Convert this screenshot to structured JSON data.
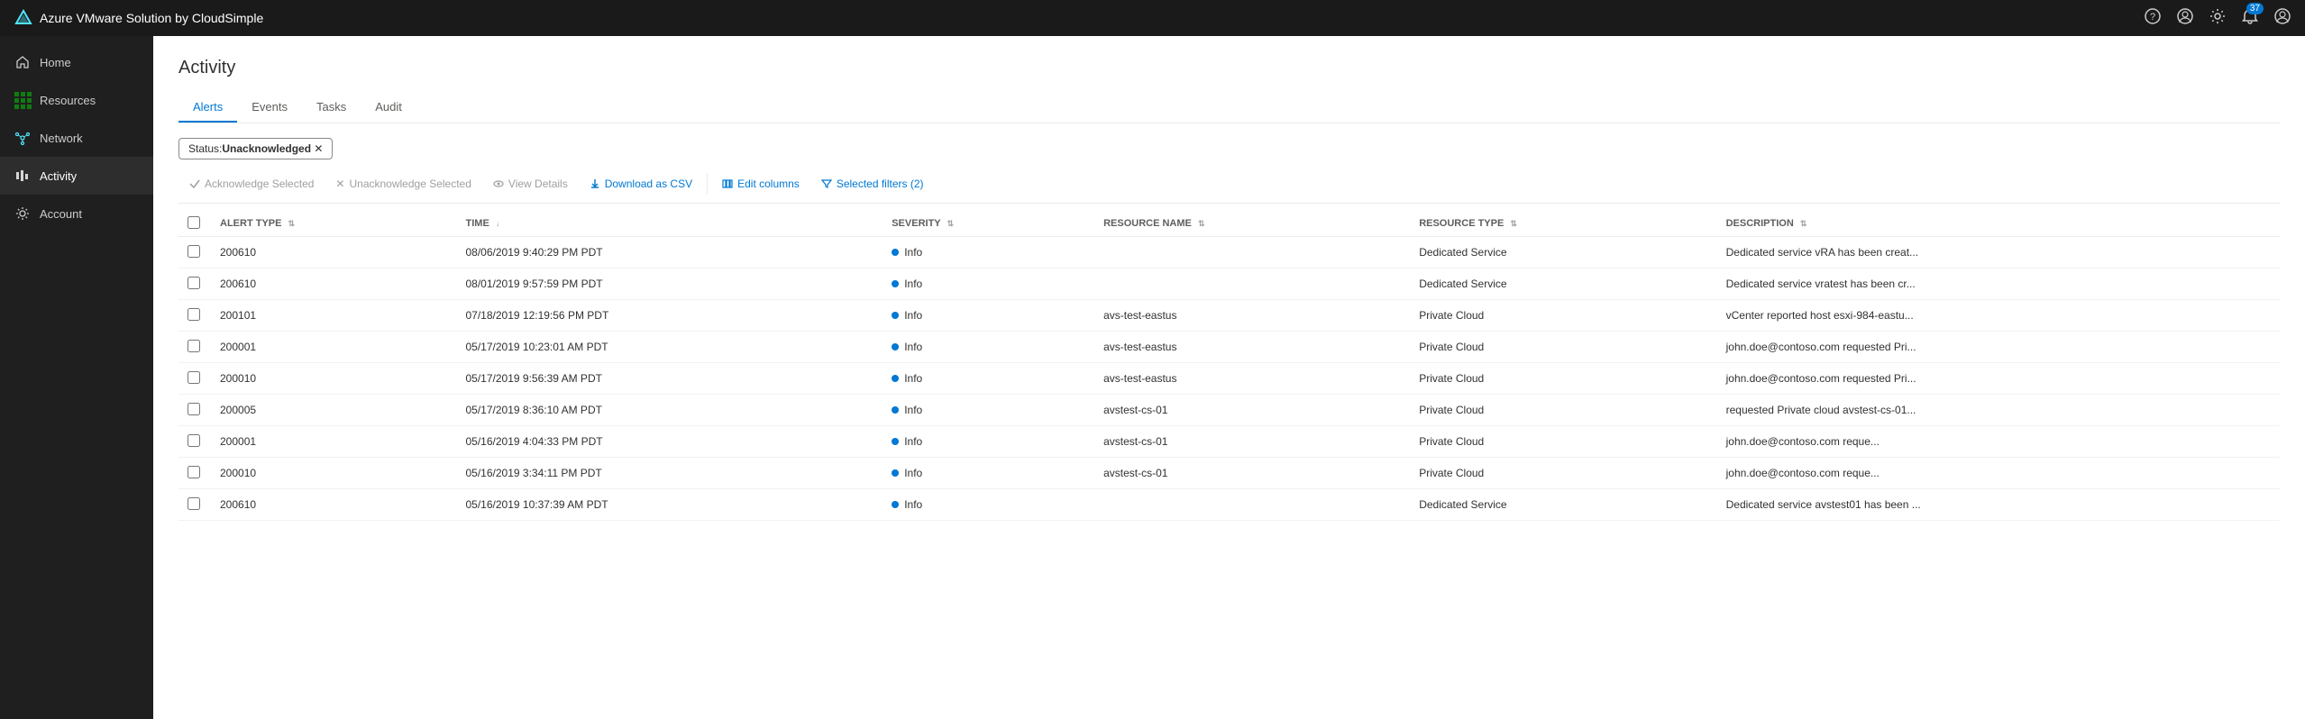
{
  "topbar": {
    "title": "Azure VMware Solution by CloudSimple",
    "notification_count": "37"
  },
  "sidebar": {
    "items": [
      {
        "id": "home",
        "label": "Home",
        "icon": "home"
      },
      {
        "id": "resources",
        "label": "Resources",
        "icon": "resources"
      },
      {
        "id": "network",
        "label": "Network",
        "icon": "network"
      },
      {
        "id": "activity",
        "label": "Activity",
        "icon": "activity",
        "active": true
      },
      {
        "id": "account",
        "label": "Account",
        "icon": "account"
      }
    ]
  },
  "page": {
    "title": "Activity"
  },
  "tabs": [
    {
      "id": "alerts",
      "label": "Alerts",
      "active": true
    },
    {
      "id": "events",
      "label": "Events",
      "active": false
    },
    {
      "id": "tasks",
      "label": "Tasks",
      "active": false
    },
    {
      "id": "audit",
      "label": "Audit",
      "active": false
    }
  ],
  "filter_badge": {
    "prefix": "Status: ",
    "value": "Unacknowledged"
  },
  "toolbar": {
    "acknowledge_label": "Acknowledge Selected",
    "unacknowledge_label": "Unacknowledge Selected",
    "view_details_label": "View Details",
    "download_label": "Download as CSV",
    "edit_columns_label": "Edit columns",
    "selected_filters_label": "Selected filters (2)"
  },
  "table": {
    "columns": [
      {
        "id": "alert_type",
        "label": "ALERT TYPE"
      },
      {
        "id": "time",
        "label": "TIME"
      },
      {
        "id": "severity",
        "label": "SEVERITY"
      },
      {
        "id": "resource_name",
        "label": "RESOURCE NAME"
      },
      {
        "id": "resource_type",
        "label": "RESOURCE TYPE"
      },
      {
        "id": "description",
        "label": "DESCRIPTION"
      }
    ],
    "rows": [
      {
        "alert_type": "200610",
        "time": "08/06/2019 9:40:29 PM PDT",
        "severity": "Info",
        "resource_name": "",
        "resource_type": "Dedicated Service",
        "description": "Dedicated service vRA has been creat..."
      },
      {
        "alert_type": "200610",
        "time": "08/01/2019 9:57:59 PM PDT",
        "severity": "Info",
        "resource_name": "",
        "resource_type": "Dedicated Service",
        "description": "Dedicated service vratest has been cr..."
      },
      {
        "alert_type": "200101",
        "time": "07/18/2019 12:19:56 PM PDT",
        "severity": "Info",
        "resource_name": "avs-test-eastus",
        "resource_type": "Private Cloud",
        "description": "vCenter reported host esxi-984-eastu..."
      },
      {
        "alert_type": "200001",
        "time": "05/17/2019 10:23:01 AM PDT",
        "severity": "Info",
        "resource_name": "avs-test-eastus",
        "resource_type": "Private Cloud",
        "description": "john.doe@contoso.com  requested Pri..."
      },
      {
        "alert_type": "200010",
        "time": "05/17/2019 9:56:39 AM PDT",
        "severity": "Info",
        "resource_name": "avs-test-eastus",
        "resource_type": "Private Cloud",
        "description": "john.doe@contoso.com  requested Pri..."
      },
      {
        "alert_type": "200005",
        "time": "05/17/2019 8:36:10 AM PDT",
        "severity": "Info",
        "resource_name": "avstest-cs-01",
        "resource_type": "Private Cloud",
        "description": "requested Private cloud avstest-cs-01..."
      },
      {
        "alert_type": "200001",
        "time": "05/16/2019 4:04:33 PM PDT",
        "severity": "Info",
        "resource_name": "avstest-cs-01",
        "resource_type": "Private Cloud",
        "description": "john.doe@contoso.com    reque..."
      },
      {
        "alert_type": "200010",
        "time": "05/16/2019 3:34:11 PM PDT",
        "severity": "Info",
        "resource_name": "avstest-cs-01",
        "resource_type": "Private Cloud",
        "description": "john.doe@contoso.com    reque..."
      },
      {
        "alert_type": "200610",
        "time": "05/16/2019 10:37:39 AM PDT",
        "severity": "Info",
        "resource_name": "",
        "resource_type": "Dedicated Service",
        "description": "Dedicated service avstest01 has been ..."
      }
    ]
  }
}
